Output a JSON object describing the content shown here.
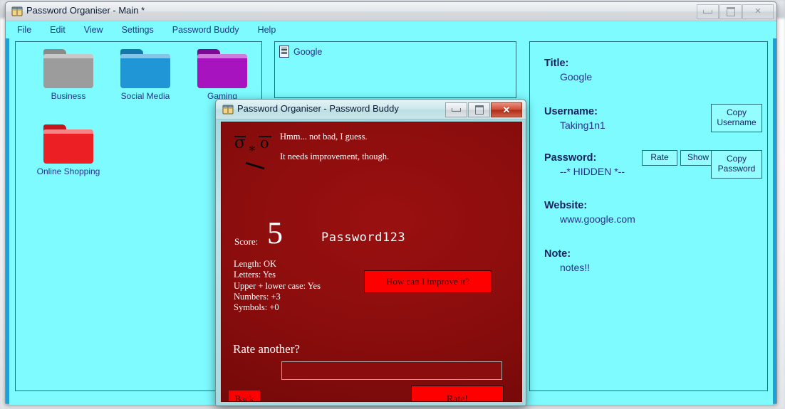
{
  "main_window": {
    "title": "Password Organiser - Main *",
    "icon": "book-icon",
    "controls": {
      "minimize": "–",
      "maximize": "□",
      "close": "✕"
    },
    "menu": [
      {
        "label": "File"
      },
      {
        "label": "Edit"
      },
      {
        "label": "View"
      },
      {
        "label": "Settings"
      },
      {
        "label": "Password Buddy"
      },
      {
        "label": "Help"
      }
    ]
  },
  "folders": [
    {
      "label": "Business",
      "color": "#9c9c9c",
      "tab": "#8a8a8a"
    },
    {
      "label": "Social Media",
      "color": "#2196d6",
      "tab": "#1478ac"
    },
    {
      "label": "Gaming",
      "color": "#a813c0",
      "tab": "#7d0a94"
    },
    {
      "label": "Online Shopping",
      "color": "#ec2024",
      "tab": "#c5151a"
    }
  ],
  "entry_list": [
    {
      "label": "Google",
      "icon": "document-icon"
    }
  ],
  "details": {
    "title_label": "Title:",
    "title_value": "Google",
    "username_label": "Username:",
    "username_value": "Taking1n1",
    "password_label": "Password:",
    "password_value": "--* HIDDEN *--",
    "website_label": "Website:",
    "website_value": "www.google.com",
    "note_label": "Note:",
    "note_value": "notes!!",
    "buttons": {
      "copy_username": "Copy\nUsername",
      "copy_username_line1": "Copy",
      "copy_username_line2": "Username",
      "rate": "Rate",
      "show": "Show",
      "copy_password_line1": "Copy",
      "copy_password_line2": "Password"
    }
  },
  "buddy_dialog": {
    "title": "Password Organiser - Password Buddy",
    "icon": "book-icon",
    "controls": {
      "minimize": "–",
      "maximize": "□",
      "close": "✕"
    },
    "face": "σ̅ * o̅",
    "message_line1": "Hmm... not bad, I guess.",
    "message_line2": "It needs improvement, though.",
    "score_label": "Score:",
    "score_value": "5",
    "rated_password": "Password123",
    "criteria": [
      "Length: OK",
      "Letters: Yes",
      "Upper + lower case: Yes",
      "Numbers: +3",
      "Symbols: +0"
    ],
    "improve_button": "How can I improve it?",
    "rate_another_label": "Rate another?",
    "rate_input_value": "",
    "rate_input_placeholder": "",
    "back_button": "Back",
    "rate_button": "Rate!"
  },
  "colors": {
    "app_background": "#7dfbff",
    "window_frame": "#1ba0d8",
    "panel_border": "#20707a",
    "text_blue": "#26348c",
    "label_blue": "#14205e",
    "dialog_dark_red": "#8b0d0d",
    "button_red": "#fe0000"
  }
}
